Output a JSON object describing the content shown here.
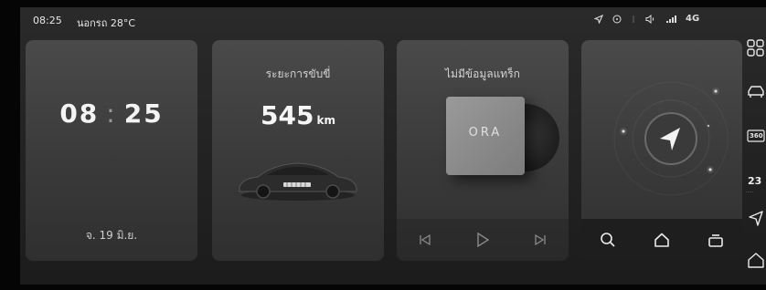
{
  "status_bar": {
    "time": "08:25",
    "weather": "นอกรถ 28°C",
    "network": "4G"
  },
  "clock_card": {
    "hour": "08",
    "minute": "25",
    "separator": ":",
    "date": "จ. 19 มิ.ย."
  },
  "range_card": {
    "title": "ระยะการขับขี่",
    "value": "545",
    "unit": "km"
  },
  "music_card": {
    "title": "ไม่มีข้อมูลแทร็ก",
    "album_logo": "ORA",
    "controls": [
      "previous-track-icon",
      "play-icon",
      "next-track-icon"
    ]
  },
  "nav_card": {
    "actions": [
      "search-icon",
      "home-icon",
      "route-icon"
    ]
  },
  "dock": {
    "items": [
      "apps-grid-icon",
      "car-icon",
      "camera-360-icon",
      "temperature",
      "navigation-icon",
      "home-icon"
    ],
    "temperature": "23",
    "camera_label": "360"
  },
  "colors": {
    "background": "#1c1c1c",
    "card": "#424242",
    "text": "#f4f4f4"
  }
}
